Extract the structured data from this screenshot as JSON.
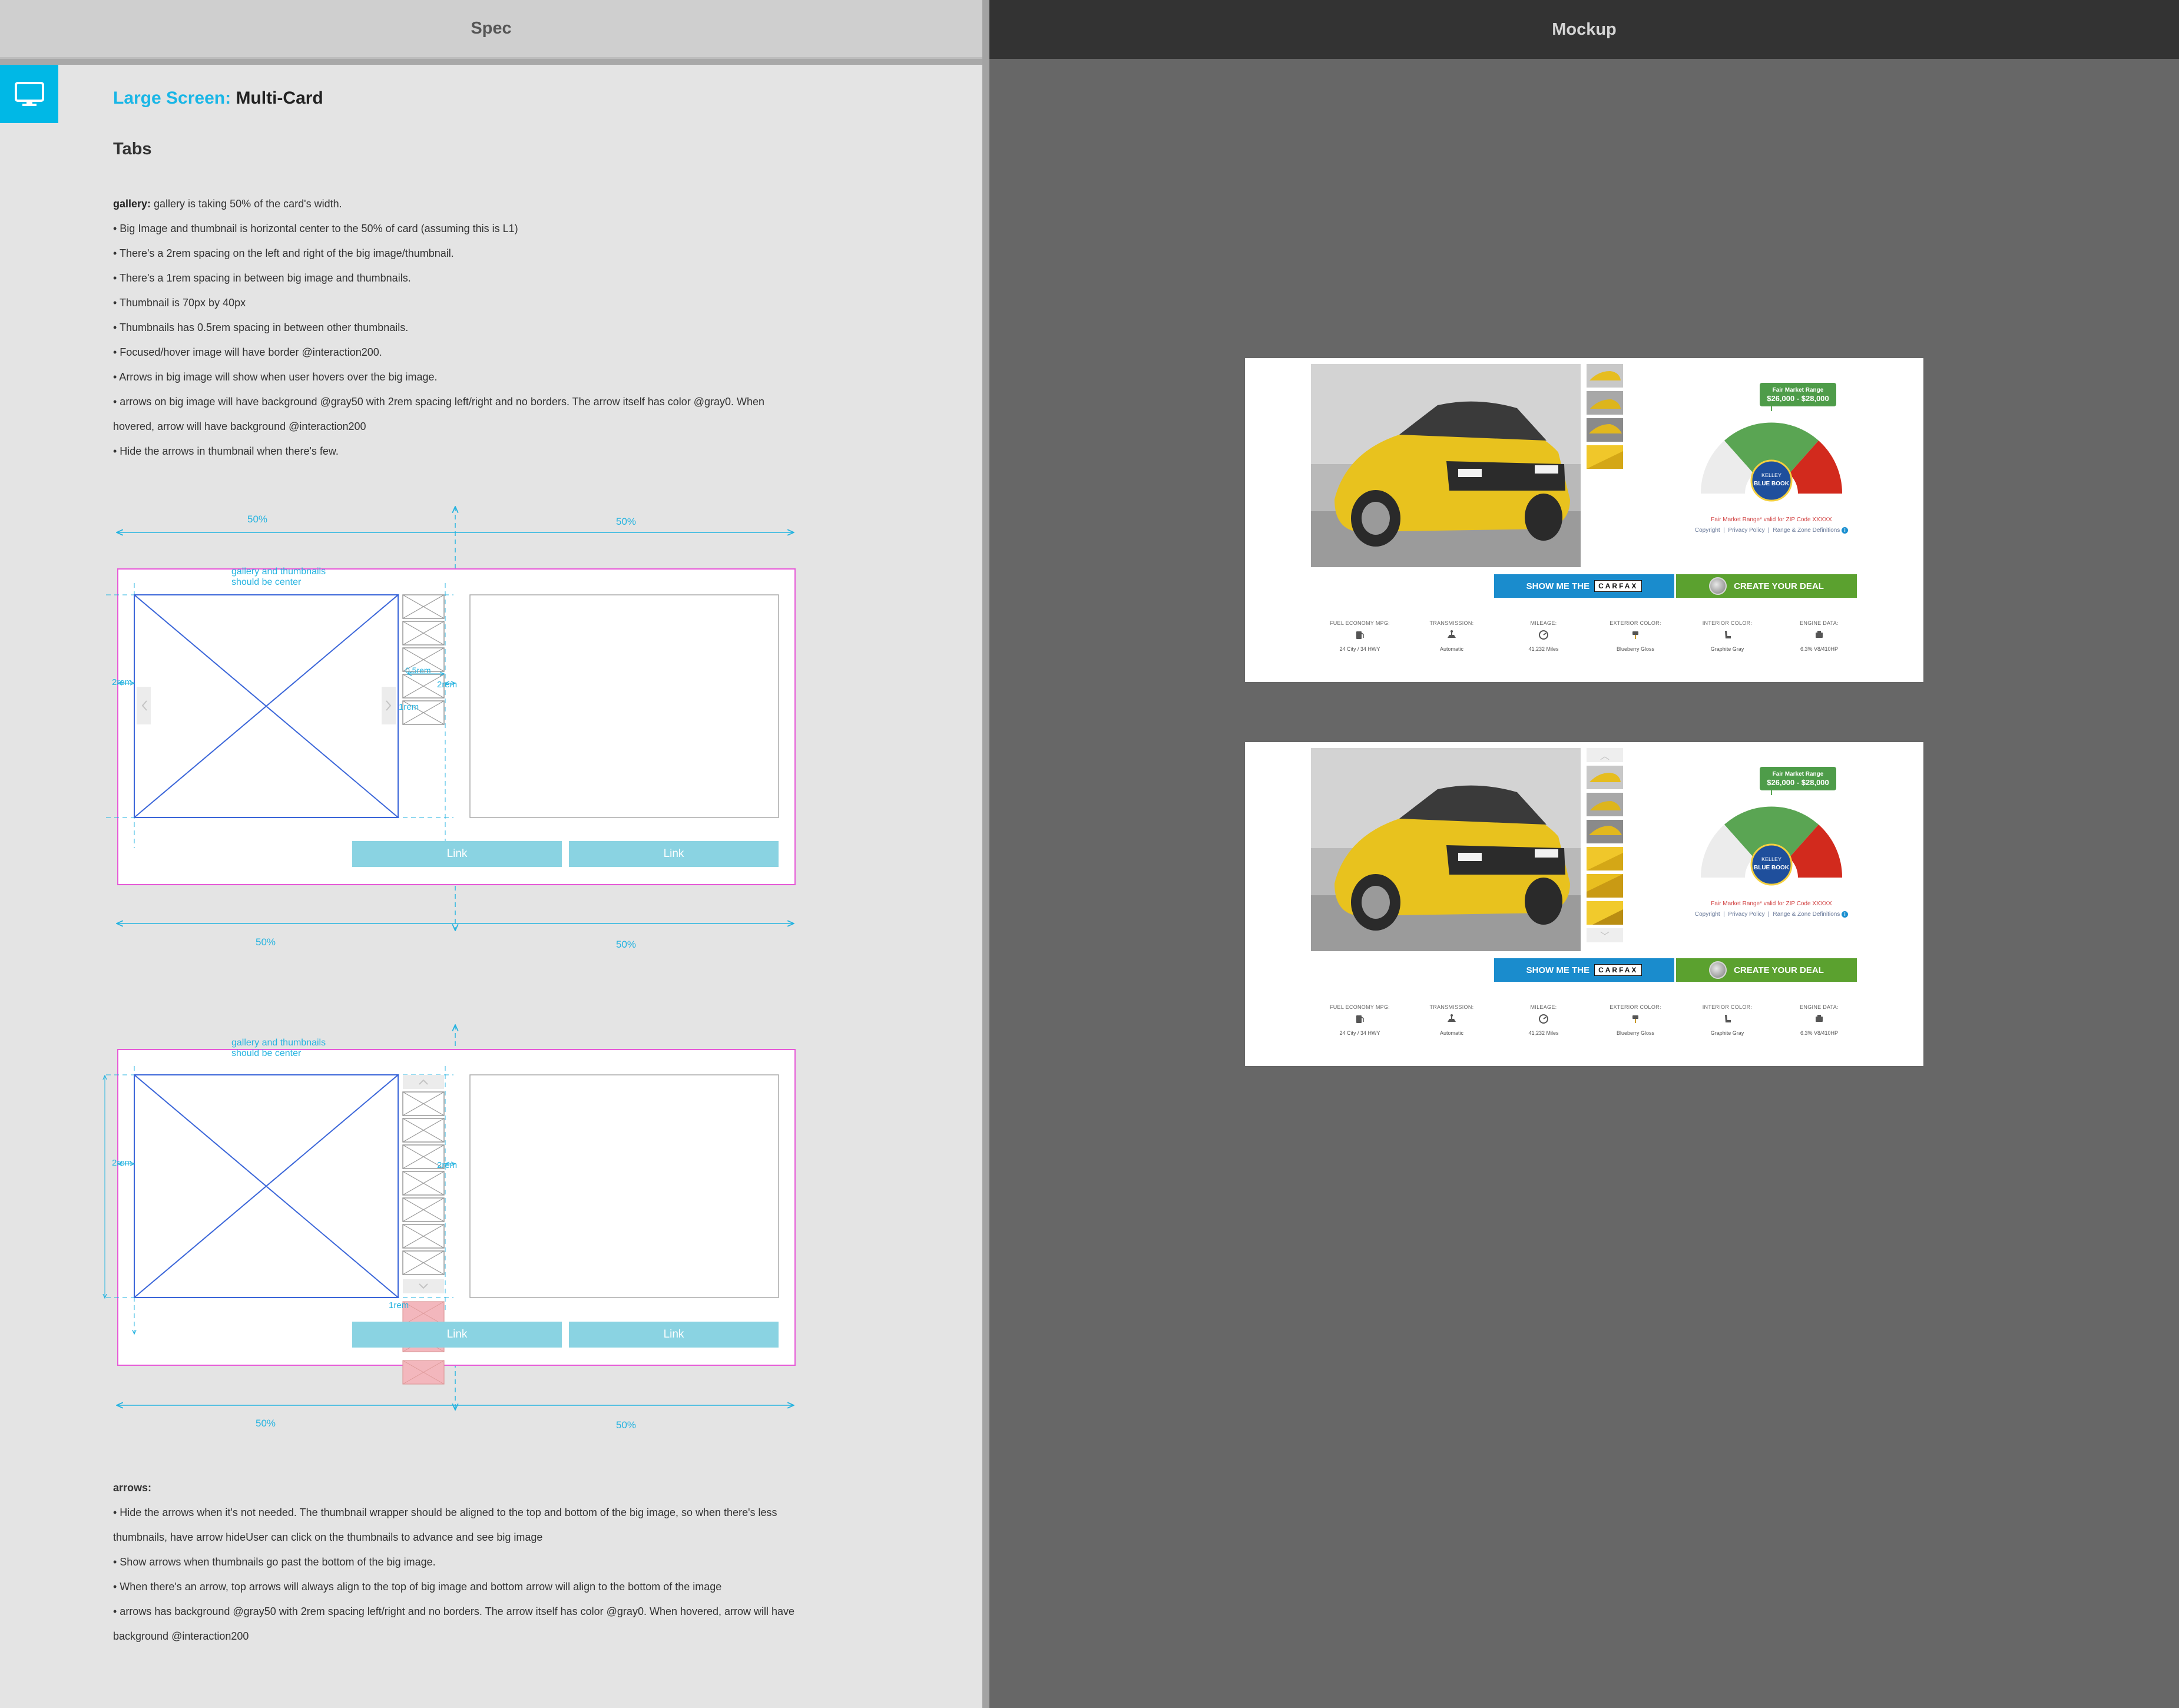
{
  "headers": {
    "spec": "Spec",
    "mockup": "Mockup"
  },
  "spec": {
    "title_highlight": "Large Screen:",
    "title_name": "Multi-Card",
    "subtitle": "Tabs",
    "gallery_lead": "gallery:",
    "gallery_desc": " gallery is taking 50% of the card's width.",
    "bullets": [
      "• Big Image and thumbnail is horizontal  center to the 50% of card (assuming this is L1)",
      "• There's a 2rem spacing on the left and right of the big image/thumbnail.",
      "• There's a 1rem spacing in between big image and thumbnails.",
      "• Thumbnail is 70px by 40px",
      "• Thumbnails has 0.5rem spacing in between other thumbnails.",
      "• Focused/hover image will have border @interaction200.",
      "• Arrows in big image will show when user hovers over the big image.",
      "• arrows on big image will have background @gray50 with 2rem spacing left/right and no borders. The arrow itself has color @gray0. When",
      "hovered, arrow will have background @interaction200",
      "• Hide the arrows in thumbnail when there's few."
    ],
    "wireframe": {
      "pct_half": "50%",
      "center_note_1": "gallery and thumbnails",
      "center_note_2": "should be center",
      "rem2": "2rem",
      "rem1": "1rem",
      "rem05": "0.5rem",
      "link_label": "Link"
    },
    "arrows_lead": "arrows:",
    "arrows_bullets": [
      "• Hide the arrows when it's not needed. The thumbnail wrapper should be aligned to the top and bottom of the big image, so when there's less",
      "thumbnails, have arrow hideUser can click on the thumbnails to advance and see big image",
      "• Show arrows when thumbnails go past the bottom of the big image.",
      "• When there's an arrow, top arrows will always align to the top of big image and bottom arrow will align to the bottom of the image",
      "• arrows has background @gray50 with 2rem spacing left/right and no borders. The arrow itself has color @gray0. When hovered, arrow will have",
      "background @interaction200"
    ]
  },
  "mockup": {
    "kbb_tag_title": "Fair Market Range",
    "kbb_tag_range": "$26,000 - $28,000",
    "kbb_badge_1": "KELLEY",
    "kbb_badge_2": "BLUE BOOK",
    "fmr_note": "Fair Market Range* valid for ZIP Code XXXXX",
    "legal_copyright": "Copyright",
    "legal_privacy": "Privacy Policy",
    "legal_range": "Range & Zone Definitions",
    "carfax_prefix": "SHOW ME THE",
    "carfax_logo": "CARFAX",
    "deal_label": "CREATE YOUR DEAL",
    "specs": [
      {
        "label": "FUEL ECONOMY MPG:",
        "value": "24 City / 34 HWY",
        "icon": "fuel-icon"
      },
      {
        "label": "TRANSMISSION:",
        "value": "Automatic",
        "icon": "transmission-icon"
      },
      {
        "label": "MILEAGE:",
        "value": "41,232 Miles",
        "icon": "odometer-icon"
      },
      {
        "label": "EXTERIOR COLOR:",
        "value": "Blueberry Gloss",
        "icon": "paint-icon"
      },
      {
        "label": "INTERIOR COLOR:",
        "value": "Graphite Gray",
        "icon": "seat-icon"
      },
      {
        "label": "ENGINE DATA:",
        "value": "6.3% V8/410HP",
        "icon": "engine-icon"
      }
    ]
  },
  "colors": {
    "accent_cyan": "#19b6e6",
    "card_border": "#e65ad7",
    "link_button": "#8ad3e2",
    "carfax_blue": "#1a8ccd",
    "deal_green": "#5ba12f"
  }
}
